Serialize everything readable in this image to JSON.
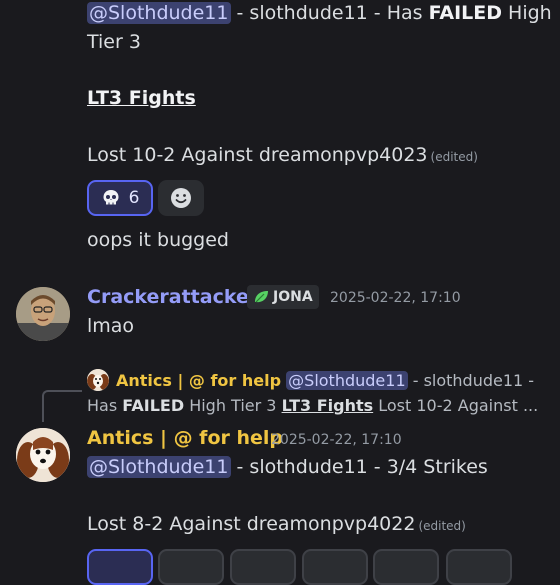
{
  "top_message": {
    "mention": "@Slothdude11",
    "text_a": " - slothdude11 - Has ",
    "failed": "FAILED",
    "text_b": " High",
    "line2": "Tier 3",
    "heading": "LT3 Fights",
    "result": "Lost 10-2 Against dreamonpvp4023",
    "edited": "(edited)",
    "reaction_count": "6",
    "reaction_icon": "skull-emoji",
    "add_reaction_icon": "add-reaction-icon"
  },
  "bugged_message": {
    "text": "oops it bugged"
  },
  "cracker_message": {
    "username": "Crackerattacker",
    "tag_icon": "leaf-icon",
    "tag": "JONA",
    "timestamp": "2025-02-22, 17:10",
    "text": "lmao",
    "username_color": "#949cf7"
  },
  "reply_preview": {
    "username": "Antics | @ for help",
    "mention": "@Slothdude11",
    "text_a": " - slothdude11 -",
    "line2_a": "Has ",
    "failed": "FAILED",
    "line2_b": " High Tier 3  ",
    "heading": "LT3 Fights",
    "line2_c": "  Lost 10-2 Against ..."
  },
  "antics_message": {
    "username": "Antics | @ for help",
    "timestamp": "2025-02-22, 17:10",
    "mention": "@Slothdude11",
    "text": " - slothdude11 - 3/4 Strikes",
    "result": "Lost 8-2 Against dreamonpvp4022",
    "edited": "(edited)",
    "username_color": "#f0c542"
  },
  "colors": {
    "background": "#1a1a1e",
    "mention_bg": "#3c4270",
    "reaction_border": "#5865f2"
  }
}
